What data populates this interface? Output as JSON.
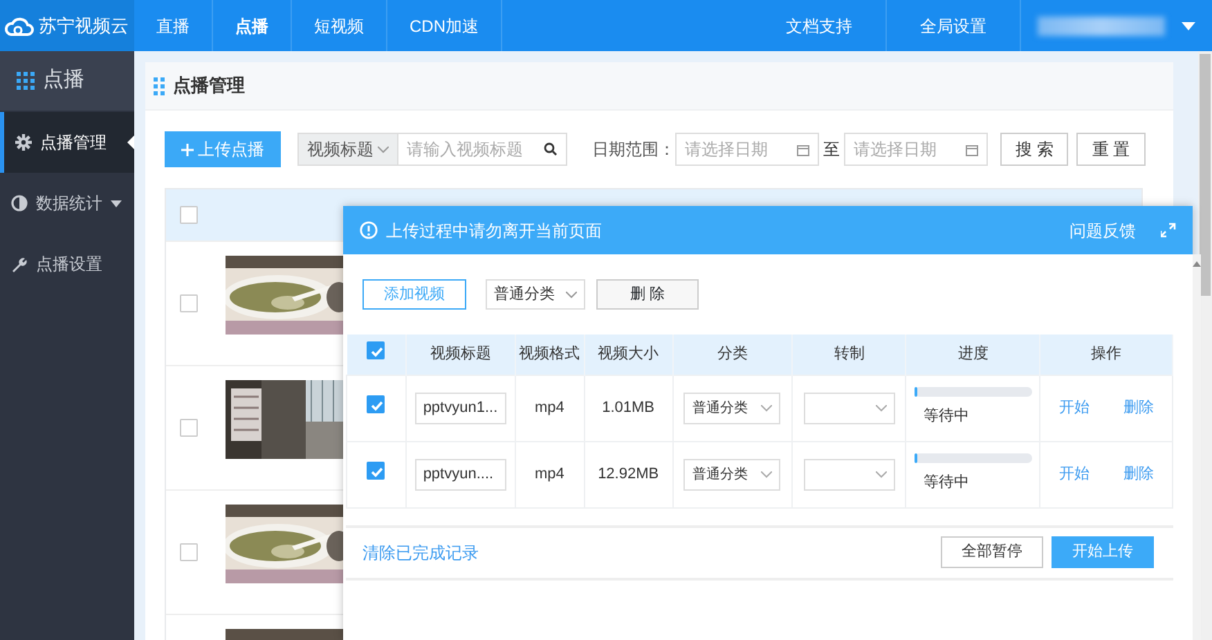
{
  "brand": {
    "name": "苏宁视频云"
  },
  "nav": {
    "items": [
      {
        "label": "直播",
        "selected": false
      },
      {
        "label": "点播",
        "selected": true
      },
      {
        "label": "短视频",
        "selected": false
      },
      {
        "label": "CDN加速",
        "selected": false
      }
    ],
    "right_items": [
      "文档支持",
      "全局设置"
    ]
  },
  "sidebar": {
    "title": "点播",
    "items": [
      {
        "label": "点播管理",
        "selected": true,
        "expandable": false
      },
      {
        "label": "数据统计",
        "selected": false,
        "expandable": true
      },
      {
        "label": "点播设置",
        "selected": false,
        "expandable": false
      }
    ]
  },
  "panel": {
    "title": "点播管理"
  },
  "toolbar": {
    "upload_button": "上传点播",
    "search_type": "视频标题",
    "search_placeholder": "请输入视频标题",
    "date_label": "日期范围：",
    "date_from_placeholder": "请选择日期",
    "date_separator": "至",
    "date_to_placeholder": "请选择日期",
    "buttons": [
      "搜 索",
      "重 置"
    ]
  },
  "video_table": {
    "header_checked": false,
    "rows": [
      {
        "kind": "soup",
        "checked": false
      },
      {
        "kind": "room",
        "checked": false
      },
      {
        "kind": "soup",
        "checked": false
      },
      {
        "kind": "soup"
      }
    ]
  },
  "upload_dialog": {
    "notice": "上传过程中请勿离开当前页面",
    "feedback": "问题反馈",
    "actions": {
      "add": "添加视频",
      "category": "普通分类",
      "delete": "删 除"
    },
    "columns": [
      "视频标题",
      "视频格式",
      "视频大小",
      "分类",
      "转制",
      "进度",
      "操作"
    ],
    "header_checked": true,
    "rows": [
      {
        "checked": true,
        "title": "pptvyun1...",
        "format": "mp4",
        "size": "1.01MB",
        "category": "普通分类",
        "level": 0,
        "status": "等待中",
        "actions": [
          "开始",
          "删除"
        ]
      },
      {
        "checked": true,
        "title": "pptvyun....",
        "format": "mp4",
        "size": "12.92MB",
        "category": "普通分类",
        "level": 0,
        "status": "等待中",
        "actions": [
          "开始",
          "删除"
        ]
      }
    ],
    "clear_link": "清除已完成记录",
    "footer_buttons": [
      {
        "label": "全部暂停",
        "primary": false
      },
      {
        "label": "开始上传",
        "primary": true
      }
    ]
  }
}
